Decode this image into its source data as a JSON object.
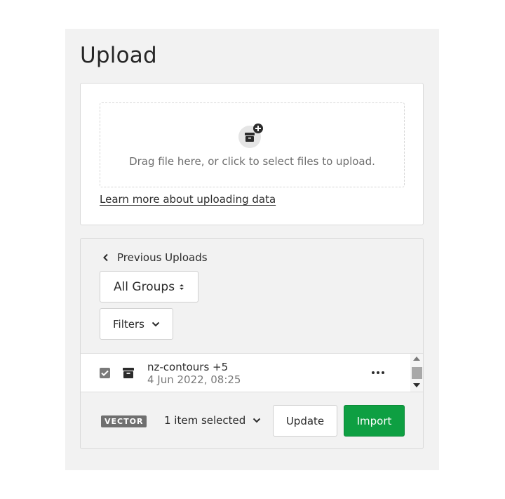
{
  "page": {
    "title": "Upload"
  },
  "upload": {
    "icon": "archive-plus-icon",
    "drop_text": "Drag file here, or click to select files to upload.",
    "learn_link": "Learn more about uploading data"
  },
  "previous": {
    "back_label": "Previous Uploads",
    "groups_label": "All Groups",
    "groups_icon": "sort-arrows-icon",
    "filters_label": "Filters",
    "items": [
      {
        "name": "nz-contours +5",
        "date": "4 Jun 2022, 08:25",
        "checked": true,
        "icon": "archive-icon"
      }
    ]
  },
  "footer": {
    "badge": "VECTOR",
    "selected_label": "1 item selected",
    "update_label": "Update",
    "import_label": "Import"
  },
  "colors": {
    "panel": "#f2f2f2",
    "import": "#0e9f42",
    "badge": "#6f6f6f"
  }
}
